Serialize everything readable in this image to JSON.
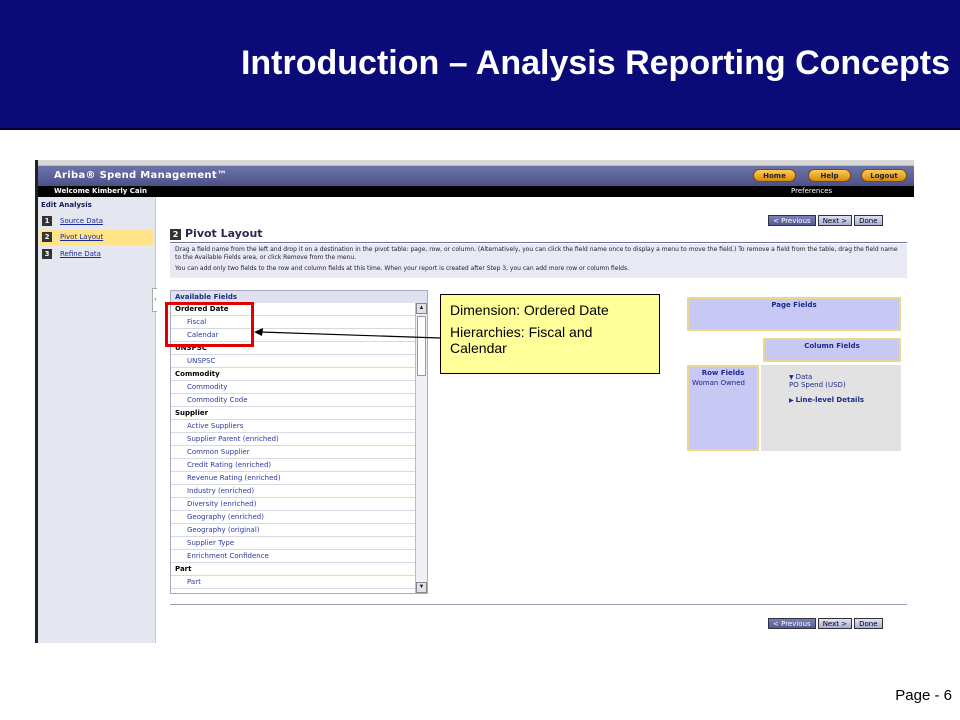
{
  "slide": {
    "title": "Introduction – Analysis Reporting Concepts",
    "page": "Page - 6"
  },
  "app": {
    "title": "Ariba® Spend Management™",
    "top_buttons": [
      "Home",
      "Help",
      "Logout"
    ],
    "welcome": "Welcome Kimberly Cain",
    "preferences": "Preferences"
  },
  "leftnav": {
    "heading": "Edit Analysis",
    "steps": [
      {
        "num": "1",
        "label": "Source Data"
      },
      {
        "num": "2",
        "label": "Pivot Layout"
      },
      {
        "num": "3",
        "label": "Refine Data"
      }
    ]
  },
  "main": {
    "buttons": {
      "previous": "< Previous",
      "next": "Next >",
      "done": "Done"
    },
    "step_num": "2",
    "step_title": "Pivot Layout",
    "instructions": [
      "Drag a field name from the left and drop it on a destination in the pivot table: page, row, or column. (Alternatively, you can click the field name once to display a menu to move the field.) To remove a field from the table, drag the field name to the Available Fields area, or click Remove from the menu.",
      "You can add only two fields to the row and column fields at this time. When your report is created after Step 3, you can add more row or column fields."
    ],
    "available_fields": {
      "title": "Available Fields",
      "items": [
        {
          "text": "Ordered Date",
          "type": "dim"
        },
        {
          "text": "Fiscal",
          "type": "hier"
        },
        {
          "text": "Calendar",
          "type": "hier"
        },
        {
          "text": "UNSPSC",
          "type": "dim"
        },
        {
          "text": "UNSPSC",
          "type": "hier"
        },
        {
          "text": "Commodity",
          "type": "dim"
        },
        {
          "text": "Commodity",
          "type": "hier"
        },
        {
          "text": "Commodity Code",
          "type": "hier"
        },
        {
          "text": "Supplier",
          "type": "dim"
        },
        {
          "text": "Active Suppliers",
          "type": "hier"
        },
        {
          "text": "Supplier Parent (enriched)",
          "type": "hier"
        },
        {
          "text": "Common Supplier",
          "type": "hier"
        },
        {
          "text": "Credit Rating (enriched)",
          "type": "hier"
        },
        {
          "text": "Revenue Rating (enriched)",
          "type": "hier"
        },
        {
          "text": "Industry (enriched)",
          "type": "hier"
        },
        {
          "text": "Diversity (enriched)",
          "type": "hier"
        },
        {
          "text": "Geography (enriched)",
          "type": "hier"
        },
        {
          "text": "Geography (original)",
          "type": "hier"
        },
        {
          "text": "Supplier Type",
          "type": "hier"
        },
        {
          "text": "Enrichment Confidence",
          "type": "hier"
        },
        {
          "text": "Part",
          "type": "dim"
        },
        {
          "text": "Part",
          "type": "hier"
        }
      ]
    },
    "page_fields": {
      "title": "Page Fields"
    },
    "column_fields": {
      "title": "Column Fields"
    },
    "row_fields": {
      "title": "Row Fields",
      "value": "Woman Owned"
    },
    "data_area": {
      "data_label": "Data",
      "data_value": "PO Spend (USD)",
      "line_level": "Line-level Details"
    }
  },
  "callout": {
    "line1": "Dimension: Ordered Date",
    "line2": "Hierarchies: Fiscal and Calendar"
  },
  "colors": {
    "slide_header": "#0a0a78",
    "callout_bg": "#ffff99",
    "highlight": "#e00000",
    "pivot_box": "#c8c8f4"
  }
}
